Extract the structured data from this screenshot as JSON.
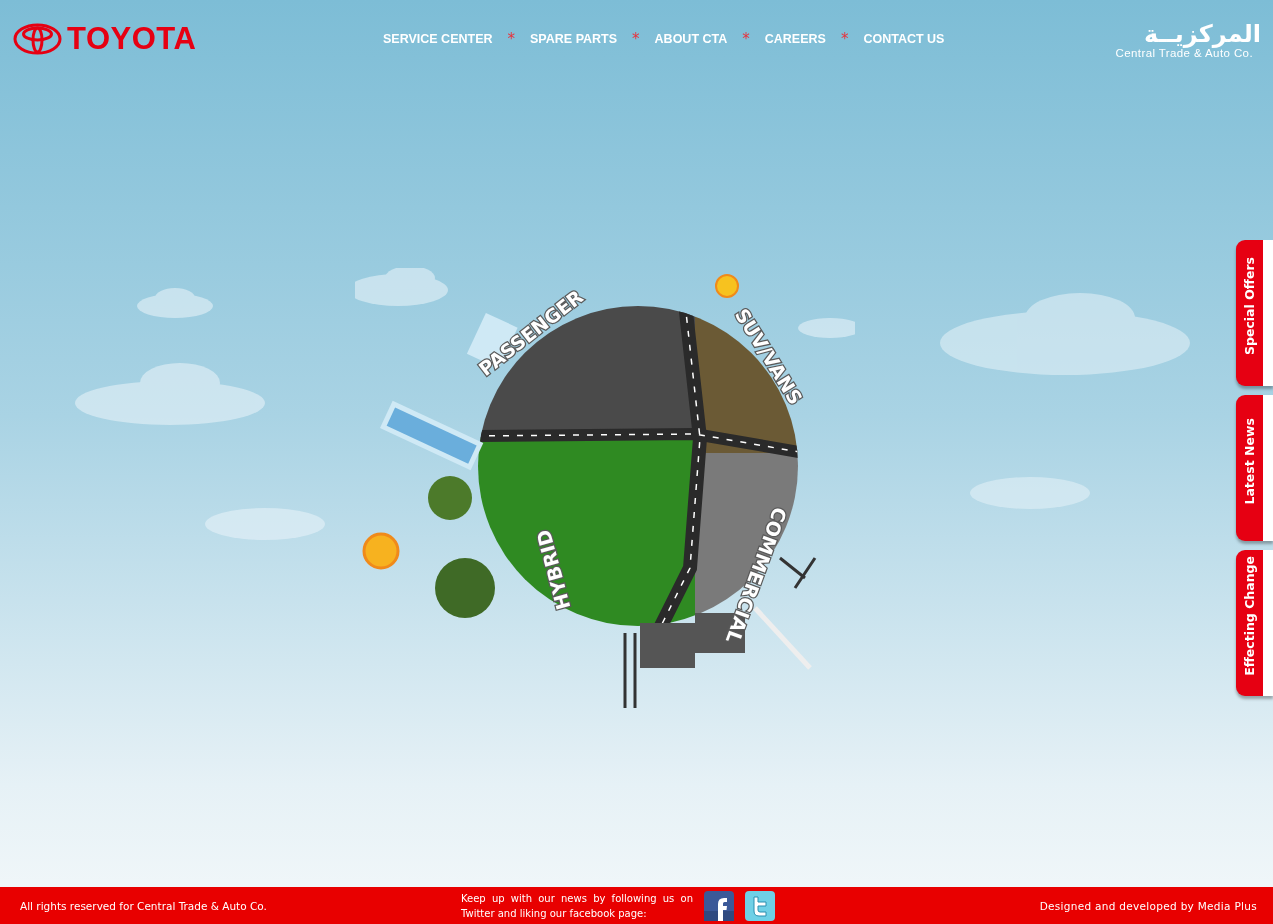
{
  "header": {
    "brand": "TOYOTA",
    "nav": [
      {
        "kind": "link",
        "label": "SERVICE CENTER"
      },
      {
        "kind": "separator",
        "label": "*"
      },
      {
        "kind": "link",
        "label": "SPARE PARTS"
      },
      {
        "kind": "separator",
        "label": "*"
      },
      {
        "kind": "link",
        "label": "ABOUT CTA"
      },
      {
        "kind": "separator",
        "label": "*"
      },
      {
        "kind": "link",
        "label": "CAREERS"
      },
      {
        "kind": "separator",
        "label": "*"
      },
      {
        "kind": "link",
        "label": "CONTACT US"
      }
    ],
    "company": {
      "arabic_name": "المركزيــة",
      "english_name": "Central Trade & Auto Co."
    }
  },
  "globe": {
    "segments": [
      {
        "label": "PASSENGER"
      },
      {
        "label": "SUV/VANS"
      },
      {
        "label": "HYBRID"
      },
      {
        "label": "COMMERCIAL"
      }
    ]
  },
  "side_tabs": [
    {
      "label": "Special Offers"
    },
    {
      "label": "Latest News"
    },
    {
      "label": "Effecting Change"
    }
  ],
  "footer": {
    "copyright": "All rights reserved for Central Trade & Auto Co.",
    "follow_text": "Keep up with our news by following us on Twitter and liking our facebook page:",
    "credit": "Designed and developed by Media Plus"
  }
}
